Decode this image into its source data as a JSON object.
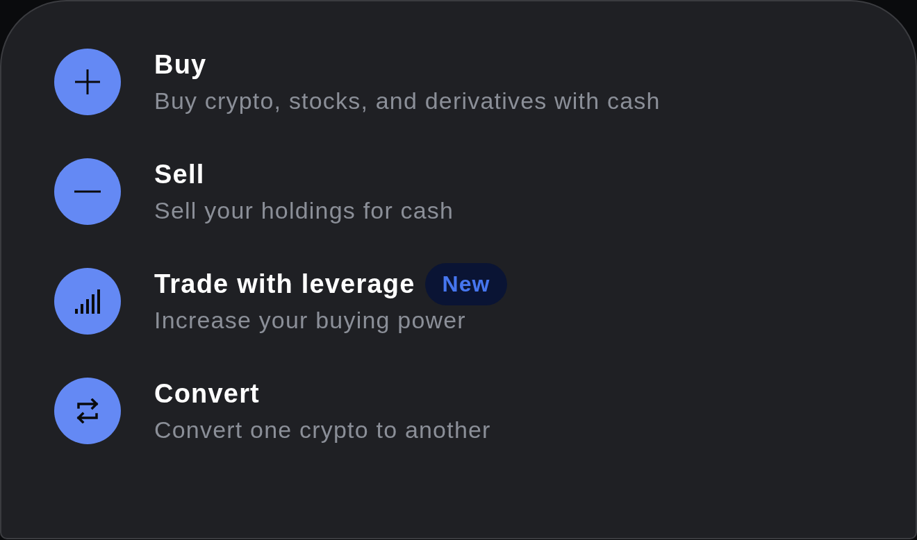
{
  "menu": {
    "items": [
      {
        "title": "Buy",
        "description": "Buy crypto, stocks, and derivatives with cash"
      },
      {
        "title": "Sell",
        "description": "Sell your holdings for cash"
      },
      {
        "title": "Trade with leverage",
        "badge": "New",
        "description": "Increase your buying power"
      },
      {
        "title": "Convert",
        "description": "Convert one crypto to another"
      }
    ]
  }
}
